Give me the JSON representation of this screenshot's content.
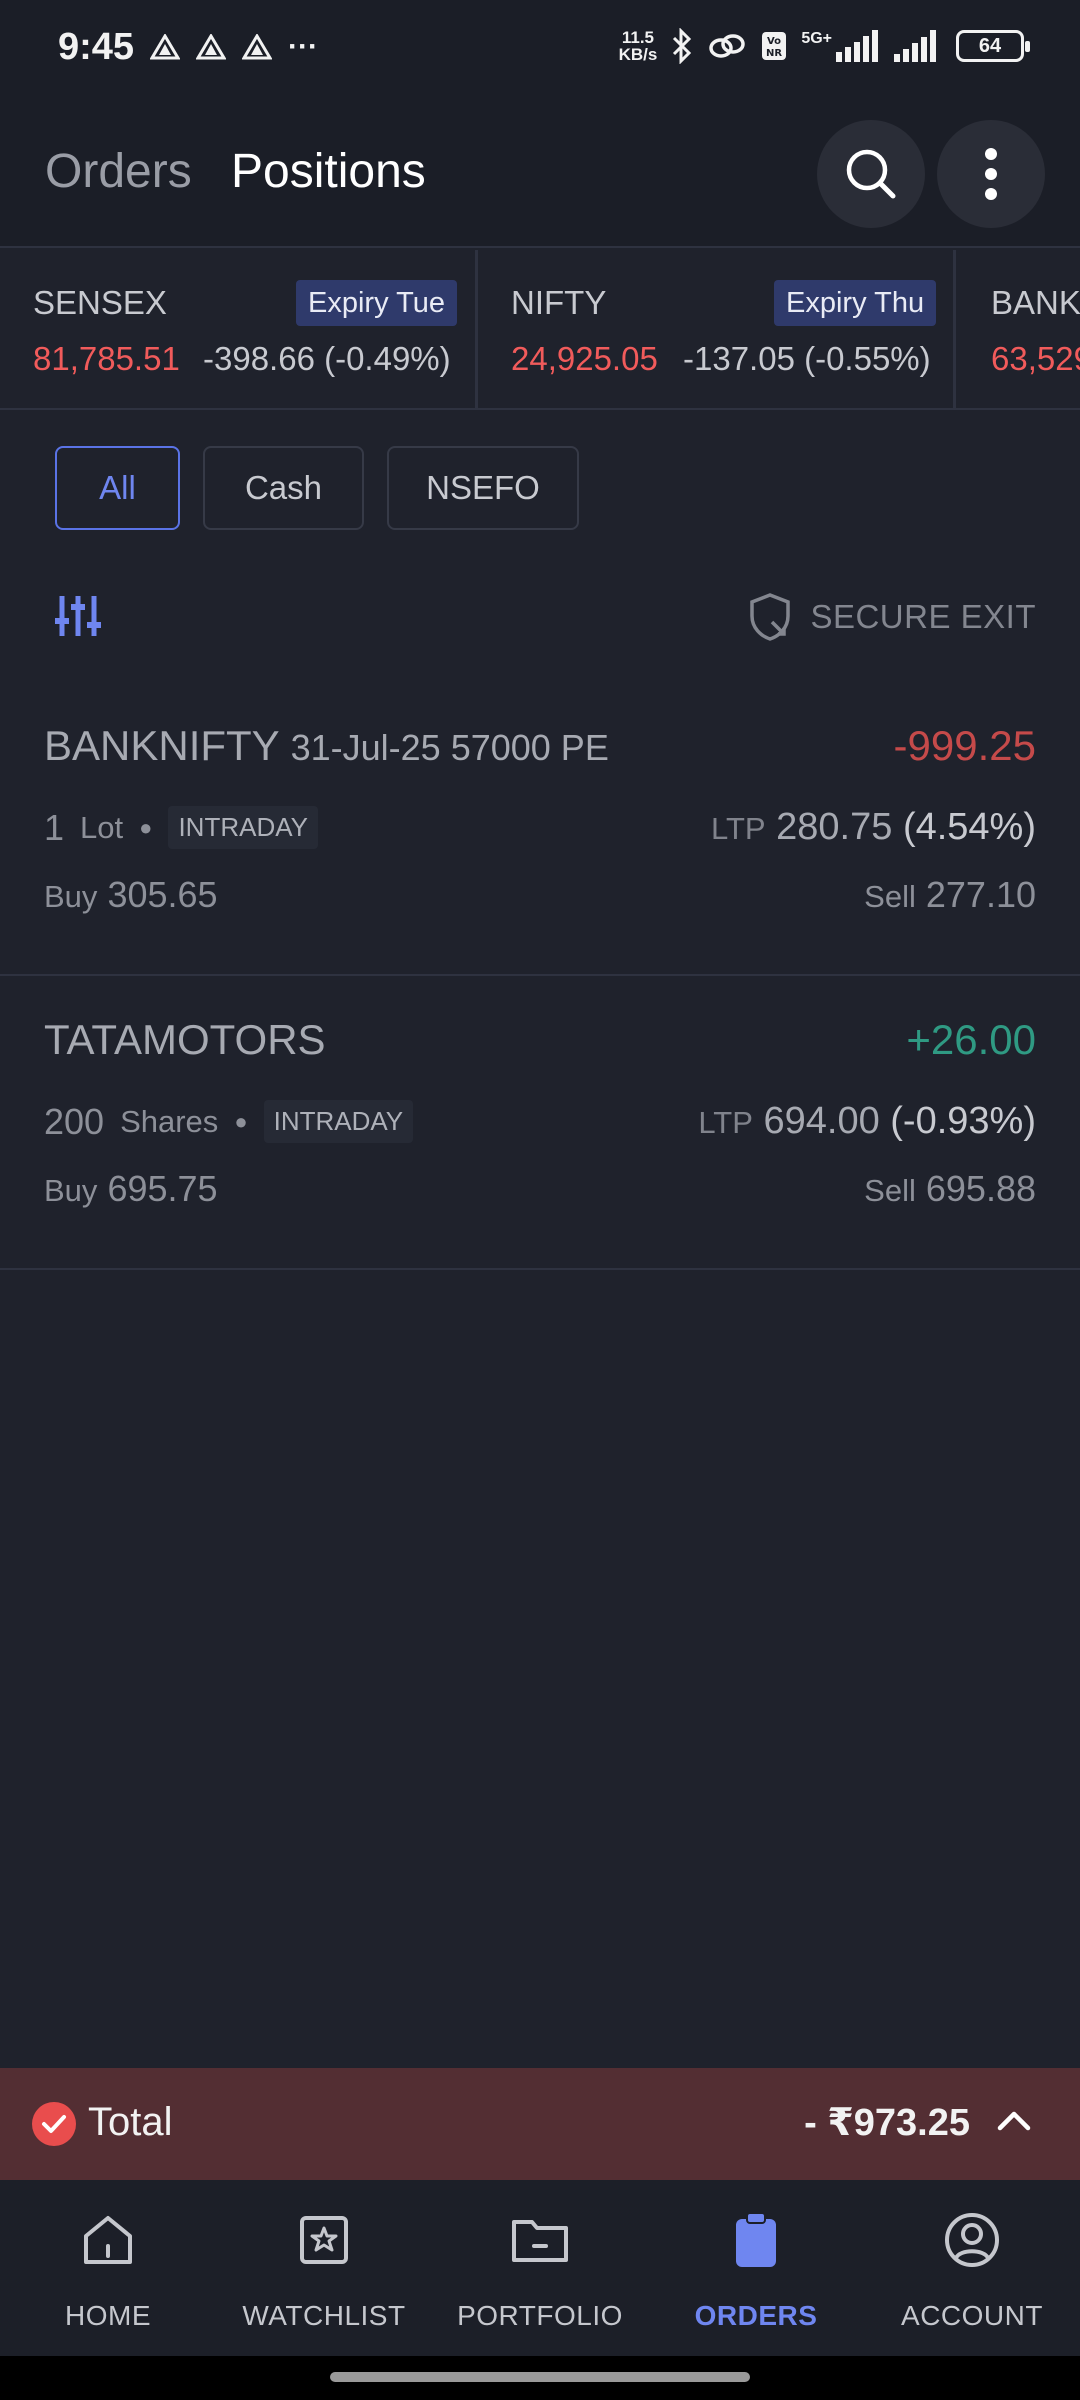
{
  "status_bar": {
    "time": "9:45",
    "more": "···",
    "net_speed_value": "11.5",
    "net_speed_unit": "KB/s",
    "network_type": "5G+",
    "battery": "64"
  },
  "header": {
    "tab_orders": "Orders",
    "tab_positions": "Positions"
  },
  "ticker": [
    {
      "name": "SENSEX",
      "expiry": "Expiry Tue",
      "price": "81,785.51",
      "change": "-398.66 (-0.49%)"
    },
    {
      "name": "NIFTY",
      "expiry": "Expiry Thu",
      "price": "24,925.05",
      "change": "-137.05 (-0.55%)"
    },
    {
      "name": "BANK",
      "price": "63,529"
    }
  ],
  "filters": [
    "All",
    "Cash",
    "NSEFO"
  ],
  "secure_exit": "SECURE EXIT",
  "positions": [
    {
      "symbol": "BANKNIFTY",
      "detail": "31-Jul-25 57000 PE",
      "pnl": "-999.25",
      "qty": "1",
      "unit": "Lot",
      "product": "INTRADAY",
      "ltp_label": "LTP",
      "ltp": "280.75",
      "ltp_pct": "(4.54%)",
      "buy_label": "Buy",
      "buy": "305.65",
      "sell_label": "Sell",
      "sell": "277.10"
    },
    {
      "symbol": "TATAMOTORS",
      "detail": "",
      "pnl": "+26.00",
      "qty": "200",
      "unit": "Shares",
      "product": "INTRADAY",
      "ltp_label": "LTP",
      "ltp": "694.00",
      "ltp_pct": "(-0.93%)",
      "buy_label": "Buy",
      "buy": "695.75",
      "sell_label": "Sell",
      "sell": "695.88"
    }
  ],
  "total": {
    "label": "Total",
    "value": "- ₹973.25"
  },
  "nav": [
    {
      "label": "HOME",
      "icon": "home-icon"
    },
    {
      "label": "WATCHLIST",
      "icon": "star-icon"
    },
    {
      "label": "PORTFOLIO",
      "icon": "folder-icon"
    },
    {
      "label": "ORDERS",
      "icon": "clipboard-icon",
      "active": true
    },
    {
      "label": "ACCOUNT",
      "icon": "account-icon"
    }
  ],
  "colors": {
    "accent": "#6f86f0",
    "loss": "#c54a4a",
    "profit": "#2f9a83",
    "total_bar": "#532e33"
  }
}
